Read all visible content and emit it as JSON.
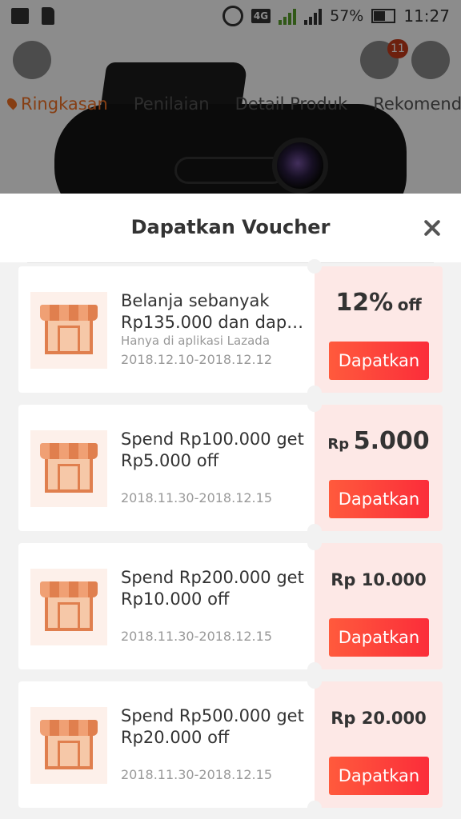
{
  "status_bar": {
    "lte_label": "4G",
    "sim1_label": "1",
    "sim2_label": "2",
    "battery": "57%",
    "time": "11:27"
  },
  "product_page": {
    "cart_count": "11",
    "tabs": [
      {
        "label": "Ringkasan",
        "active": true
      },
      {
        "label": "Penilaian",
        "active": false
      },
      {
        "label": "Detail Produk",
        "active": false
      },
      {
        "label": "Rekomendasi",
        "active": false
      }
    ]
  },
  "sheet": {
    "title": "Dapatkan Voucher",
    "vouchers": [
      {
        "title_line1": "Belanja sebanyak",
        "title_line2": "Rp135.000 dan dapat…",
        "note": "Hanya di aplikasi Lazada",
        "dates": "2018.12.10-2018.12.12",
        "amount_value": "12%",
        "amount_suffix": "off",
        "button": "Dapatkan"
      },
      {
        "title_line1": "Spend Rp100.000 get",
        "title_line2": "Rp5.000 off",
        "dates": "2018.11.30-2018.12.15",
        "amount_prefix": "Rp",
        "amount_value": "5.000",
        "button": "Dapatkan"
      },
      {
        "title_line1": "Spend Rp200.000 get",
        "title_line2": "Rp10.000 off",
        "dates": "2018.11.30-2018.12.15",
        "amount_value": "Rp 10.000",
        "button": "Dapatkan"
      },
      {
        "title_line1": "Spend Rp500.000 get",
        "title_line2": "Rp20.000 off",
        "dates": "2018.11.30-2018.12.15",
        "amount_value": "Rp 20.000",
        "button": "Dapatkan"
      }
    ]
  },
  "colors": {
    "accent": "#f57224",
    "button": "#fb3d3a",
    "voucher_right_bg": "#fde8e6"
  }
}
